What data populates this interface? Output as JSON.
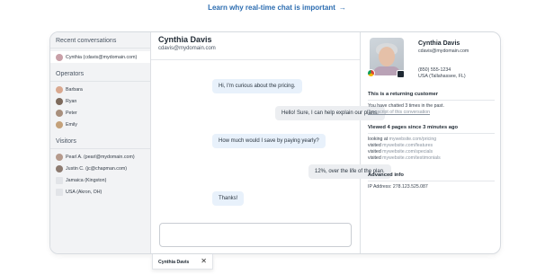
{
  "top_link": {
    "text": "Learn why real-time chat is important",
    "arrow": "→"
  },
  "sidebar": {
    "recent_title": "Recent conversations",
    "recent": [
      {
        "label": "Cynthia (cdavis@mydomain.com)",
        "avatar_color": "#c9a0a8"
      }
    ],
    "operators_title": "Operators",
    "operators": [
      {
        "label": "Barbara",
        "avatar_color": "#d9a88f"
      },
      {
        "label": "Ryan",
        "avatar_color": "#7d6a5c"
      },
      {
        "label": "Peter",
        "avatar_color": "#a88f7d"
      },
      {
        "label": "Emily",
        "avatar_color": "#c4a17a"
      }
    ],
    "visitors_title": "Visitors",
    "visitors": [
      {
        "label": "Pearl A. (pearl@mydomain.com)",
        "avatar_color": "#b59a8c"
      },
      {
        "label": "Justin C. (jc@chapman.com)",
        "avatar_color": "#8c7a70"
      },
      {
        "label": "Jamaica (Kingston)",
        "avatar_color": "#e2e4e8"
      },
      {
        "label": "USA (Akron, OH)",
        "avatar_color": "#e2e4e8"
      }
    ]
  },
  "chat": {
    "name": "Cynthia Davis",
    "email": "cdavis@mydomain.com",
    "messages": [
      {
        "dir": "in",
        "text": "Hi, I'm curious about the pricing."
      },
      {
        "dir": "out",
        "text": "Hello! Sure, I can help explain our plans."
      },
      {
        "dir": "in",
        "text": "How much would I save by paying yearly?"
      },
      {
        "dir": "out",
        "text": "12%, over the life of the plan."
      },
      {
        "dir": "in",
        "text": "Thanks!"
      }
    ],
    "composer_placeholder": ""
  },
  "info": {
    "name": "Cynthia Davis",
    "email": "cdavis@mydomain.com",
    "phone": "(850) 555-1234",
    "location": "USA (Tallahassee, FL)",
    "returning_title": "This is a returning customer",
    "returning_text": "You have chatted 3 times in the past.",
    "transcript_link": "Transcript of this conversation",
    "pages_title": "Viewed 4 pages since 3 minutes ago",
    "pages": [
      {
        "prefix": "looking at",
        "url": "mywebsite.com/pricing"
      },
      {
        "prefix": "visited",
        "url": "mywebsite.com/features"
      },
      {
        "prefix": "visited",
        "url": "mywebsite.com/specials"
      },
      {
        "prefix": "visited",
        "url": "mywebsite.com/testimonials"
      }
    ],
    "advanced_title": "Advanced info",
    "ip_text": "IP Address: 278.123.525.087",
    "icons": {
      "browser": "chrome-icon",
      "os": "apple-icon"
    }
  },
  "chat_tab": {
    "label": "Cynthia Davis",
    "close": "✕"
  }
}
